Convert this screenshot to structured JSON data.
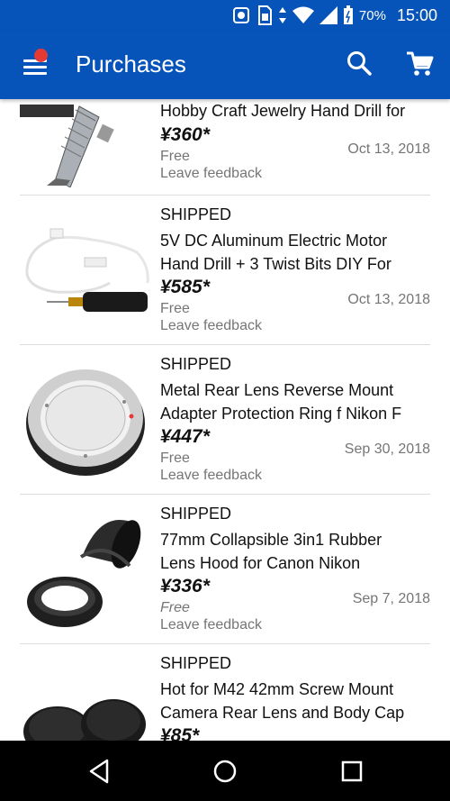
{
  "status_bar": {
    "battery": "70%",
    "time": "15:00"
  },
  "app_bar": {
    "title": "Purchases",
    "menu_icon": "hamburger-menu-icon",
    "search_icon": "search-icon",
    "cart_icon": "shopping-cart-icon"
  },
  "purchases": [
    {
      "status": "",
      "name": "Hobby Craft Jewelry Hand Drill for",
      "price": "¥360*",
      "shipping": "Free",
      "date": "Oct 13, 2018",
      "feedback": "Leave feedback",
      "image": "pin-vise-hand-drill"
    },
    {
      "status": "SHIPPED",
      "name_lines": [
        "5V DC Aluminum Electric Motor",
        "Hand Drill + 3 Twist Bits DIY For"
      ],
      "price": "¥585*",
      "shipping": "Free",
      "date": "Oct 13, 2018",
      "feedback": "Leave feedback",
      "image": "electric-mini-drill"
    },
    {
      "status": "SHIPPED",
      "name_lines": [
        "Metal Rear Lens Reverse Mount",
        "Adapter Protection Ring f Nikon F"
      ],
      "price": "¥447*",
      "shipping": "Free",
      "date": "Sep 30, 2018",
      "feedback": "Leave feedback",
      "image": "lens-adapter-ring"
    },
    {
      "status": "SHIPPED",
      "name_lines": [
        "77mm Collapsible 3in1 Rubber",
        "Lens Hood for Canon Nikon"
      ],
      "price": "¥336*",
      "shipping": "Free",
      "date": "Sep 7, 2018",
      "feedback": "Leave feedback",
      "image": "rubber-lens-hood"
    },
    {
      "status": "SHIPPED",
      "name_lines": [
        "Hot for M42 42mm Screw Mount",
        "Camera Rear Lens and Body Cap"
      ],
      "price": "¥85*",
      "image": "lens-body-caps"
    }
  ],
  "nav_bar": {
    "back_icon": "back-triangle-icon",
    "home_icon": "home-circle-icon",
    "recents_icon": "recents-square-icon"
  }
}
